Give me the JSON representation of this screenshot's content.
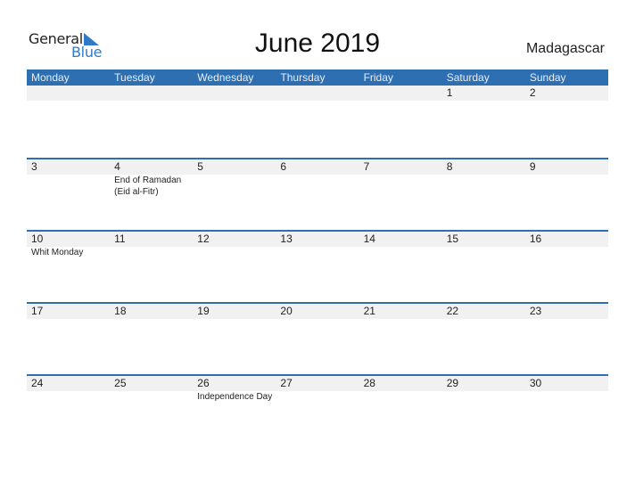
{
  "logo": {
    "line1": "General",
    "line2": "Blue"
  },
  "header": {
    "title": "June 2019",
    "country": "Madagascar"
  },
  "weekdays": [
    "Monday",
    "Tuesday",
    "Wednesday",
    "Thursday",
    "Friday",
    "Saturday",
    "Sunday"
  ],
  "weeks": [
    {
      "days": [
        {
          "num": "",
          "events": []
        },
        {
          "num": "",
          "events": []
        },
        {
          "num": "",
          "events": []
        },
        {
          "num": "",
          "events": []
        },
        {
          "num": "",
          "events": []
        },
        {
          "num": "1",
          "events": []
        },
        {
          "num": "2",
          "events": []
        }
      ]
    },
    {
      "days": [
        {
          "num": "3",
          "events": []
        },
        {
          "num": "4",
          "events": [
            "End of Ramadan",
            "(Eid al-Fitr)"
          ]
        },
        {
          "num": "5",
          "events": []
        },
        {
          "num": "6",
          "events": []
        },
        {
          "num": "7",
          "events": []
        },
        {
          "num": "8",
          "events": []
        },
        {
          "num": "9",
          "events": []
        }
      ]
    },
    {
      "days": [
        {
          "num": "10",
          "events": [
            "Whit Monday"
          ]
        },
        {
          "num": "11",
          "events": []
        },
        {
          "num": "12",
          "events": []
        },
        {
          "num": "13",
          "events": []
        },
        {
          "num": "14",
          "events": []
        },
        {
          "num": "15",
          "events": []
        },
        {
          "num": "16",
          "events": []
        }
      ]
    },
    {
      "days": [
        {
          "num": "17",
          "events": []
        },
        {
          "num": "18",
          "events": []
        },
        {
          "num": "19",
          "events": []
        },
        {
          "num": "20",
          "events": []
        },
        {
          "num": "21",
          "events": []
        },
        {
          "num": "22",
          "events": []
        },
        {
          "num": "23",
          "events": []
        }
      ]
    },
    {
      "days": [
        {
          "num": "24",
          "events": []
        },
        {
          "num": "25",
          "events": []
        },
        {
          "num": "26",
          "events": [
            "Independence Day"
          ]
        },
        {
          "num": "27",
          "events": []
        },
        {
          "num": "28",
          "events": []
        },
        {
          "num": "29",
          "events": []
        },
        {
          "num": "30",
          "events": []
        }
      ]
    }
  ],
  "colors": {
    "accent": "#2e6fb2",
    "logo_blue": "#2f7ac8",
    "strip": "#f1f1f1"
  }
}
